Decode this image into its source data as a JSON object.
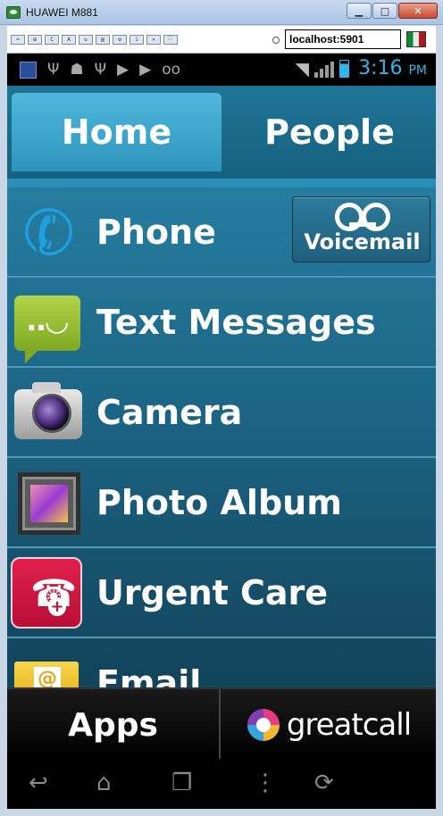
{
  "window": {
    "title": "HUAWEI M881",
    "controls": [
      "▁",
      "□",
      "✕"
    ]
  },
  "toolbar": {
    "icons": [
      "ctrl-alt-del",
      "win-key",
      "ctrl",
      "alt",
      "refresh",
      "clipboard",
      "options",
      "connection",
      "disconnect",
      "fullscreen"
    ],
    "address": "localhost:5901"
  },
  "status_bar": {
    "icons": [
      "app-icon",
      "usb-icon",
      "android-debug-icon",
      "usb-icon",
      "play-store-icon",
      "play-icon",
      "voicemail-icon"
    ],
    "time": "3:16",
    "ampm": "PM",
    "accent_color": "#33b5e5"
  },
  "tabs": [
    {
      "label": "Home",
      "selected": true
    },
    {
      "label": "People",
      "selected": false
    }
  ],
  "list": [
    {
      "label": "Phone",
      "icon": "phone-icon"
    },
    {
      "label": "Text Messages",
      "icon": "text-messages-icon"
    },
    {
      "label": "Camera",
      "icon": "camera-icon"
    },
    {
      "label": "Photo Album",
      "icon": "photo-album-icon"
    },
    {
      "label": "Urgent Care",
      "icon": "urgent-care-icon"
    },
    {
      "label": "Email",
      "icon": "email-icon"
    }
  ],
  "voicemail": {
    "label": "Voicemail"
  },
  "bottom": {
    "apps_label": "Apps",
    "brand": "greatcall"
  },
  "nav": [
    "back-icon",
    "home-icon",
    "recent-apps-icon",
    "menu-icon",
    "rotate-icon"
  ]
}
